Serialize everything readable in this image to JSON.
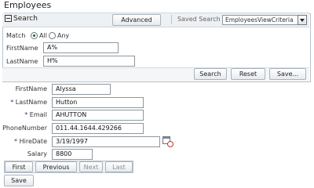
{
  "page": {
    "title": "Employees"
  },
  "search": {
    "title": "Search",
    "advanced_label": "Advanced",
    "saved_search_label": "Saved Search",
    "saved_search_value": "EmployeesViewCriteria",
    "match_label": "Match",
    "match_options": [
      "All",
      "Any"
    ],
    "match_selected": "All",
    "firstname_label": "FirstName",
    "firstname_value": "A%",
    "lastname_label": "LastName",
    "lastname_value": "H%",
    "buttons": {
      "search": "Search",
      "reset": "Reset",
      "save": "Save..."
    }
  },
  "form": {
    "firstname_label": "FirstName",
    "firstname_value": "Alyssa",
    "lastname_label": "LastName",
    "lastname_value": "Hutton",
    "email_label": "Email",
    "email_value": "AHUTTON",
    "phone_label": "PhoneNumber",
    "phone_value": "011.44.1644.429266",
    "hiredate_label": "HireDate",
    "hiredate_value": "3/19/1997",
    "salary_label": "Salary",
    "salary_value": "8800",
    "required_marker": "*"
  },
  "navigation": {
    "first": "First",
    "previous": "Previous",
    "next": "Next",
    "last": "Last"
  },
  "actions": {
    "save": "Save"
  },
  "icons": {
    "collapse": "collapse-toggle-icon",
    "dropdown": "chevron-down-icon",
    "calendar": "calendar-icon"
  }
}
